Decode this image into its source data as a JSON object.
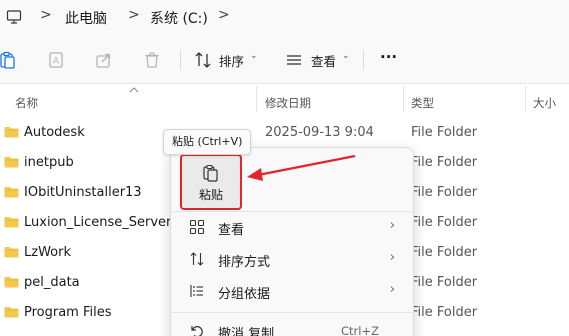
{
  "breadcrumb": {
    "items": [
      "此电脑",
      "系统 (C:)"
    ],
    "separator": ">"
  },
  "toolbar": {
    "sort_label": "排序",
    "view_label": "查看",
    "more_label": "···",
    "icons": [
      "paste-icon",
      "rename-icon",
      "share-icon",
      "delete-icon",
      "sort-icon",
      "view-icon",
      "more-icon"
    ]
  },
  "columns": {
    "name": "名称",
    "date": "修改日期",
    "type": "类型",
    "size": "大小"
  },
  "files": [
    {
      "name": "Autodesk",
      "date": "2025-09-13 9:04",
      "type": "File Folder"
    },
    {
      "name": "inetpub",
      "date": "",
      "type": "File Folder"
    },
    {
      "name": "IObitUninstaller13",
      "date": "",
      "type": "File Folder"
    },
    {
      "name": "Luxion_License_Server",
      "date": "",
      "type": "File Folder"
    },
    {
      "name": "LzWork",
      "date": "",
      "type": "File Folder"
    },
    {
      "name": "pel_data",
      "date": "",
      "type": "File Folder"
    },
    {
      "name": "Program Files",
      "date": "",
      "type": "File Folder"
    }
  ],
  "tooltip": "粘贴 (Ctrl+V)",
  "context_menu": {
    "paste_label": "粘贴",
    "items": [
      {
        "label": "查看",
        "icon": "grid-icon",
        "submenu": true
      },
      {
        "label": "排序方式",
        "icon": "sort-icon",
        "submenu": true
      },
      {
        "label": "分组依据",
        "icon": "group-icon",
        "submenu": true
      },
      {
        "label": "撤消 复制",
        "icon": "undo-icon",
        "shortcut": "Ctrl+Z"
      }
    ]
  },
  "colors": {
    "folder": "#f2c94c",
    "highlight": "#e0262a",
    "accent": "#0067c0"
  }
}
